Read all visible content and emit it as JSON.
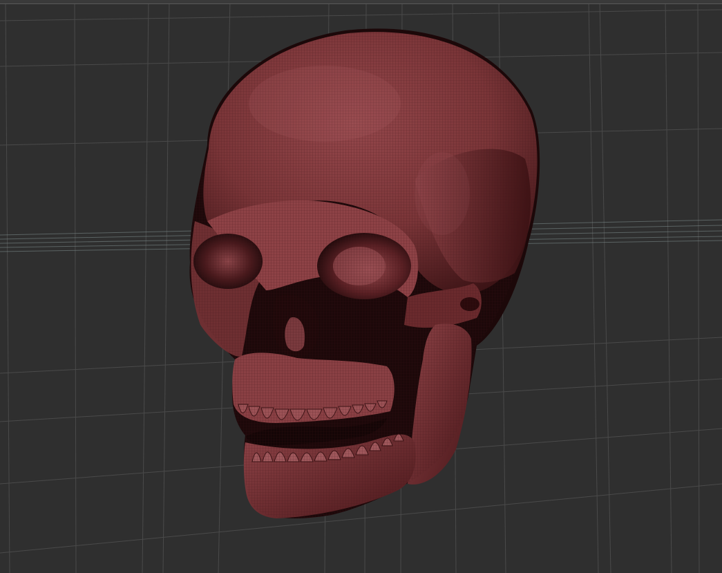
{
  "viewport": {
    "background_color": "#2f2f2f",
    "grid_color": "#5a5a5a",
    "horizon_color": "#8a9a9a"
  },
  "model": {
    "name_icon": "skull-mesh",
    "surface_color": "#7a3a3e",
    "shadow_color": "#2a0e10",
    "highlight_color": "#a4565a",
    "wire_color": "#4a1a1e",
    "wireframe": true
  }
}
